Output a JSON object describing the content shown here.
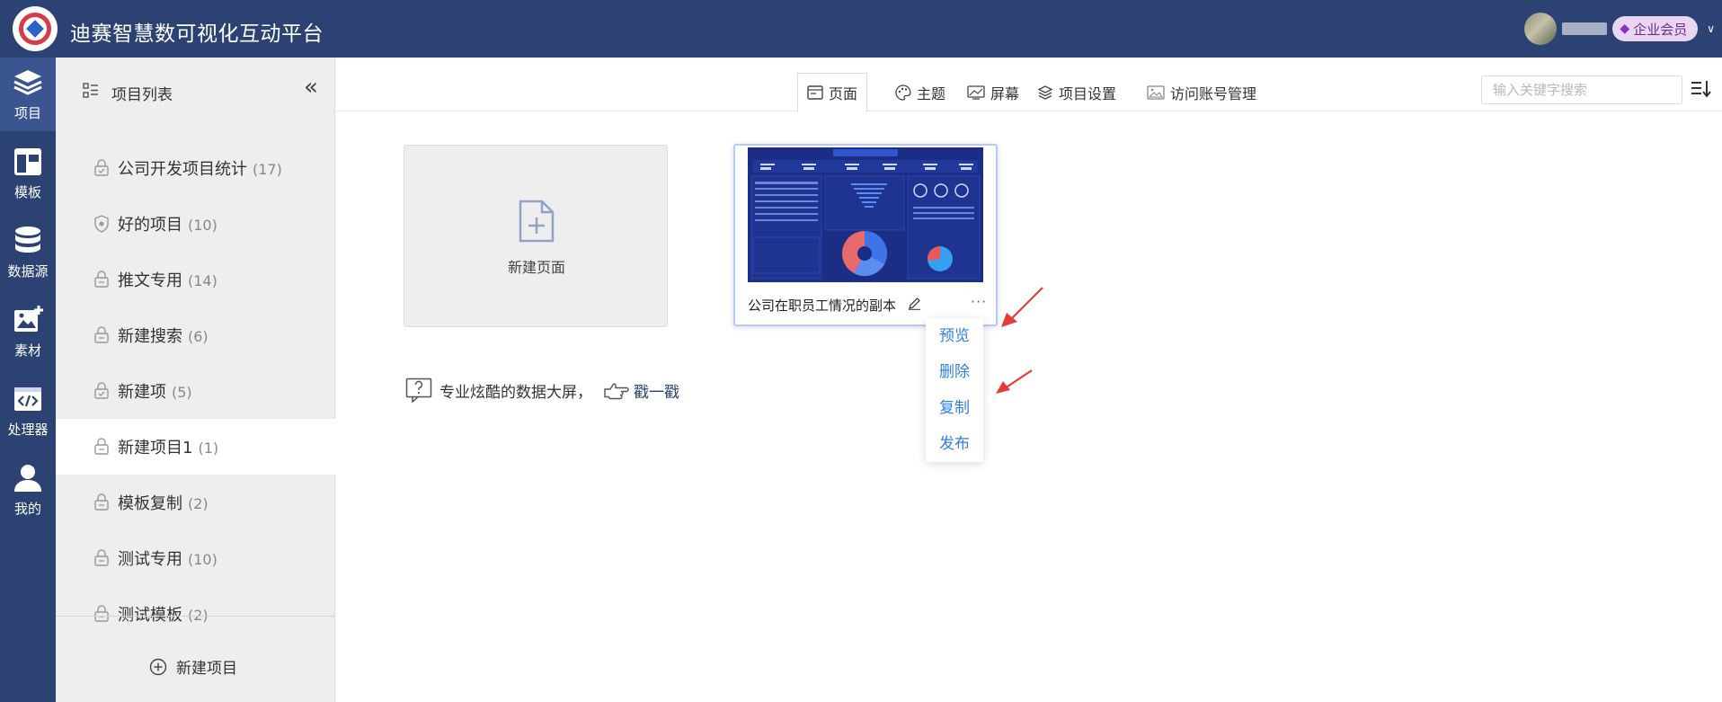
{
  "header": {
    "app_title": "迪赛智慧数可视化互动平台",
    "vip_label": "企业会员"
  },
  "leftnav": {
    "items": [
      {
        "label": "项目",
        "icon": "layers-icon"
      },
      {
        "label": "模板",
        "icon": "template-icon"
      },
      {
        "label": "数据源",
        "icon": "database-icon"
      },
      {
        "label": "素材",
        "icon": "image-add-icon"
      },
      {
        "label": "处理器",
        "icon": "code-icon"
      },
      {
        "label": "我的",
        "icon": "user-icon"
      }
    ]
  },
  "sidebar": {
    "title": "项目列表",
    "projects": [
      {
        "name": "公司开发项目统计",
        "count": "(17)"
      },
      {
        "name": "好的项目",
        "count": "(10)"
      },
      {
        "name": "推文专用",
        "count": "(14)"
      },
      {
        "name": "新建搜索",
        "count": "(6)"
      },
      {
        "name": "新建项",
        "count": "(5)"
      },
      {
        "name": "新建项目1",
        "count": "(1)"
      },
      {
        "name": "模板复制",
        "count": "(2)"
      },
      {
        "name": "测试专用",
        "count": "(10)"
      },
      {
        "name": "测试模板",
        "count": "(2)"
      }
    ],
    "new_project_label": "新建项目"
  },
  "toolbar": {
    "tabs": [
      {
        "label": "页面"
      },
      {
        "label": "主题"
      },
      {
        "label": "屏幕"
      },
      {
        "label": "项目设置"
      },
      {
        "label": "访问账号管理"
      }
    ],
    "search_placeholder": "输入关键字搜索"
  },
  "main": {
    "new_page_label": "新建页面",
    "page_card": {
      "title": "公司在职员工情况的副本",
      "more": "···"
    },
    "context_menu": [
      "预览",
      "删除",
      "复制",
      "发布"
    ],
    "hint_text": "专业炫酷的数据大屏，",
    "hint_link": "戳一戳"
  },
  "colors": {
    "header_bg": "#2b4273",
    "accent_blue": "#2f7fe0",
    "arrow_red": "#e63b3b"
  }
}
